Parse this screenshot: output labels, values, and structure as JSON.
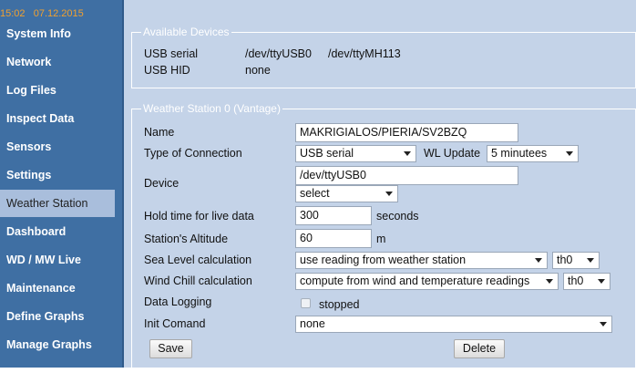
{
  "sidebar": {
    "time": "15:02",
    "date": "07.12.2015",
    "items": [
      {
        "label": "System Info"
      },
      {
        "label": "Network"
      },
      {
        "label": "Log Files"
      },
      {
        "label": "Inspect Data"
      },
      {
        "label": "Sensors"
      },
      {
        "label": "Settings"
      },
      {
        "label": "Weather Station",
        "active": true
      },
      {
        "label": "Dashboard"
      },
      {
        "label": "WD / MW Live"
      },
      {
        "label": "Maintenance"
      },
      {
        "label": "Define Graphs"
      },
      {
        "label": "Manage Graphs"
      }
    ]
  },
  "devices": {
    "legend": "Available Devices",
    "usb_serial_label": "USB serial",
    "usb_serial_value_1": "/dev/ttyUSB0",
    "usb_serial_value_2": "/dev/ttyMH113",
    "usb_hid_label": "USB HID",
    "usb_hid_value": "none"
  },
  "station": {
    "legend": "Weather Station 0 (Vantage)",
    "name_label": "Name",
    "name_value": "MAKRIGIALOS/PIERIA/SV2BZQ",
    "connection_label": "Type of Connection",
    "connection_value": "USB serial",
    "wl_update_label": "WL Update",
    "wl_update_value": "5 minutees",
    "device_label": "Device",
    "device_value": "/dev/ttyUSB0",
    "device_select_value": "select",
    "hold_label": "Hold time for live data",
    "hold_value": "300",
    "hold_unit": "seconds",
    "altitude_label": "Station's Altitude",
    "altitude_value": "60",
    "altitude_unit": "m",
    "sea_level_label": "Sea Level calculation",
    "sea_level_value": "use reading from weather station",
    "sea_level_sensor": "th0",
    "wind_chill_label": "Wind Chill calculation",
    "wind_chill_value": "compute from wind and temperature readings",
    "wind_chill_sensor": "th0",
    "logging_label": "Data Logging",
    "logging_status": "stopped",
    "init_label": "Init Comand",
    "init_value": "none",
    "save_label": "Save",
    "delete_label": "Delete"
  },
  "colors": {
    "sidebar_bg": "#3f6fa3",
    "active_bg": "#a9bedc",
    "main_bg": "#c4d3e8",
    "datetime": "#f0a030"
  }
}
